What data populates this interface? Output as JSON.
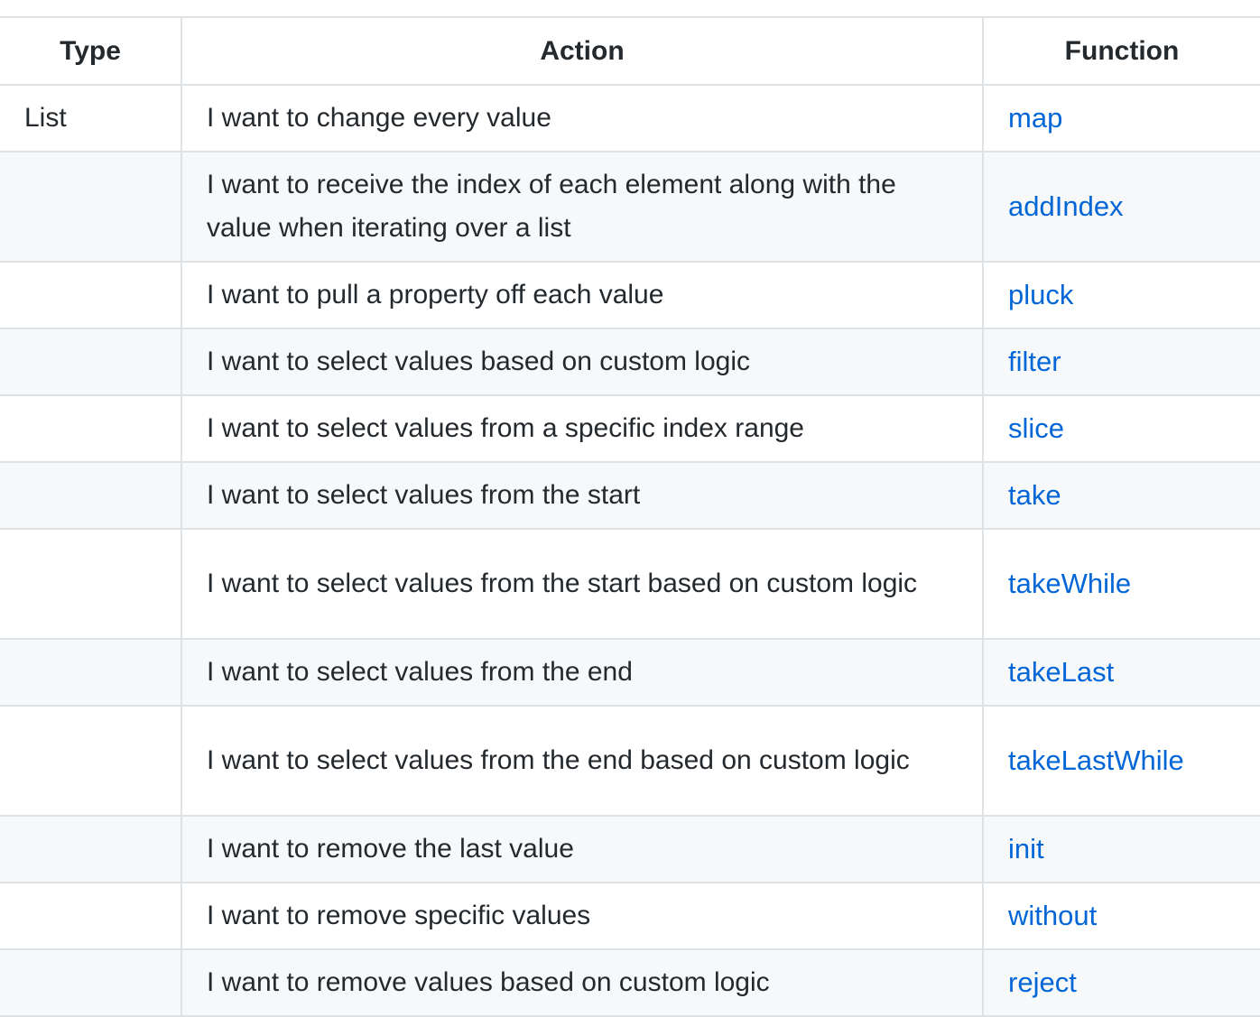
{
  "table": {
    "headers": {
      "type": "Type",
      "action": "Action",
      "function": "Function"
    },
    "rows": [
      {
        "type": "List",
        "action": "I want to change every value",
        "function": "map"
      },
      {
        "type": "",
        "action": "I want to receive the index of each element along with the value when iterating over a list",
        "function": "addIndex"
      },
      {
        "type": "",
        "action": "I want to pull a property off each value",
        "function": "pluck"
      },
      {
        "type": "",
        "action": "I want to select values based on custom logic",
        "function": "filter"
      },
      {
        "type": "",
        "action": "I want to select values from a specific index range",
        "function": "slice"
      },
      {
        "type": "",
        "action": "I want to select values from the start",
        "function": "take"
      },
      {
        "type": "",
        "action": "I want to select values from the start based on custom logic",
        "function": "takeWhile"
      },
      {
        "type": "",
        "action": "I want to select values from the end",
        "function": "takeLast"
      },
      {
        "type": "",
        "action": "I want to select values from the end based on custom logic",
        "function": "takeLastWhile"
      },
      {
        "type": "",
        "action": "I want to remove the last value",
        "function": "init"
      },
      {
        "type": "",
        "action": "I want to remove specific values",
        "function": "without"
      },
      {
        "type": "",
        "action": "I want to remove values based on custom logic",
        "function": "reject"
      }
    ]
  },
  "colors": {
    "link": "#0366d6",
    "text": "#24292e",
    "border": "#dfe2e5",
    "stripe": "#f6f8fa"
  }
}
